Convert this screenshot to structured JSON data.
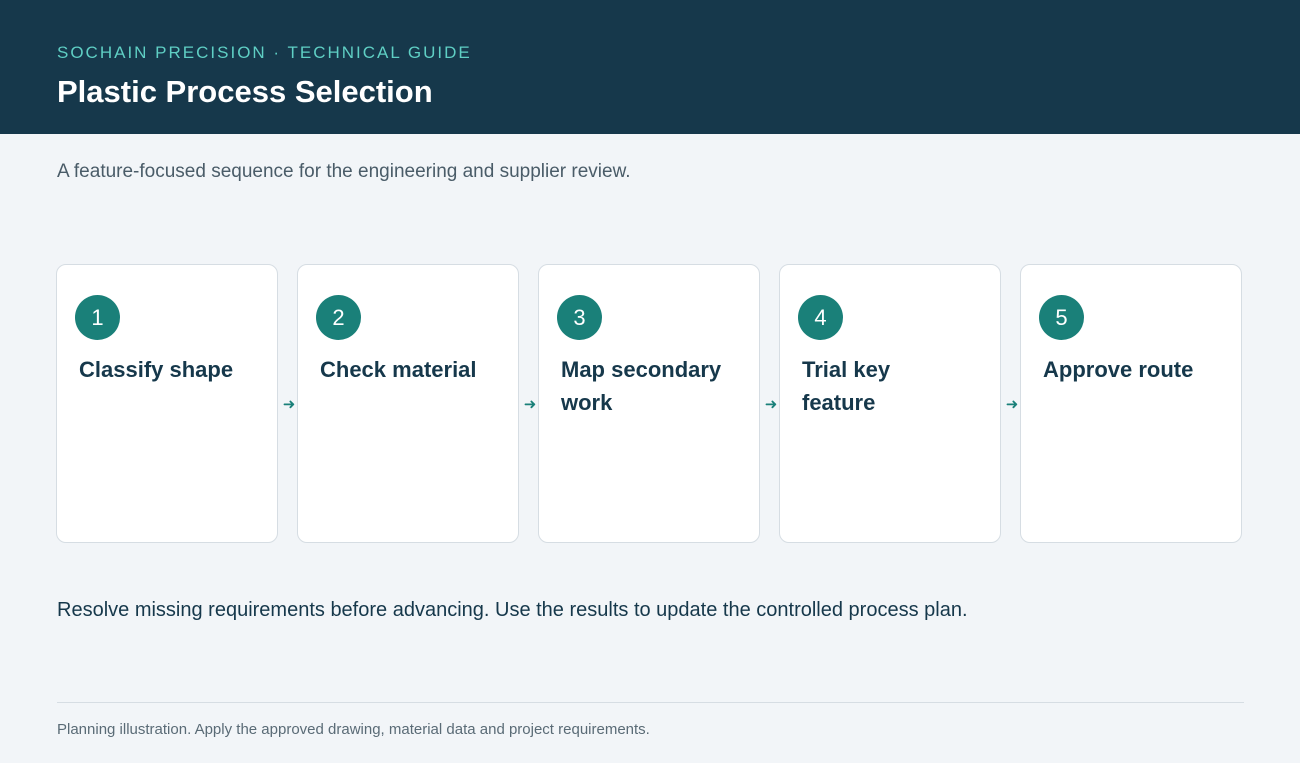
{
  "header": {
    "eyebrow": "SOCHAIN PRECISION · TECHNICAL GUIDE",
    "title": "Plastic Process Selection"
  },
  "intro": "A feature-focused sequence for the engineering and supplier review.",
  "steps": [
    {
      "number": "1",
      "label": "Classify shape"
    },
    {
      "number": "2",
      "label": "Check material"
    },
    {
      "number": "3",
      "label": "Map secondary work"
    },
    {
      "number": "4",
      "label": "Trial key feature"
    },
    {
      "number": "5",
      "label": "Approve route"
    }
  ],
  "arrow_icon": "arrow-right-icon",
  "note": "Resolve missing requirements before advancing. Use the results to update the controlled process plan.",
  "footer": "Planning illustration. Apply the approved drawing, material data and project requirements.",
  "colors": {
    "header_bg": "#16384b",
    "accent": "#1a8079",
    "eyebrow": "#5fcfc4",
    "page_bg": "#f2f5f8"
  }
}
